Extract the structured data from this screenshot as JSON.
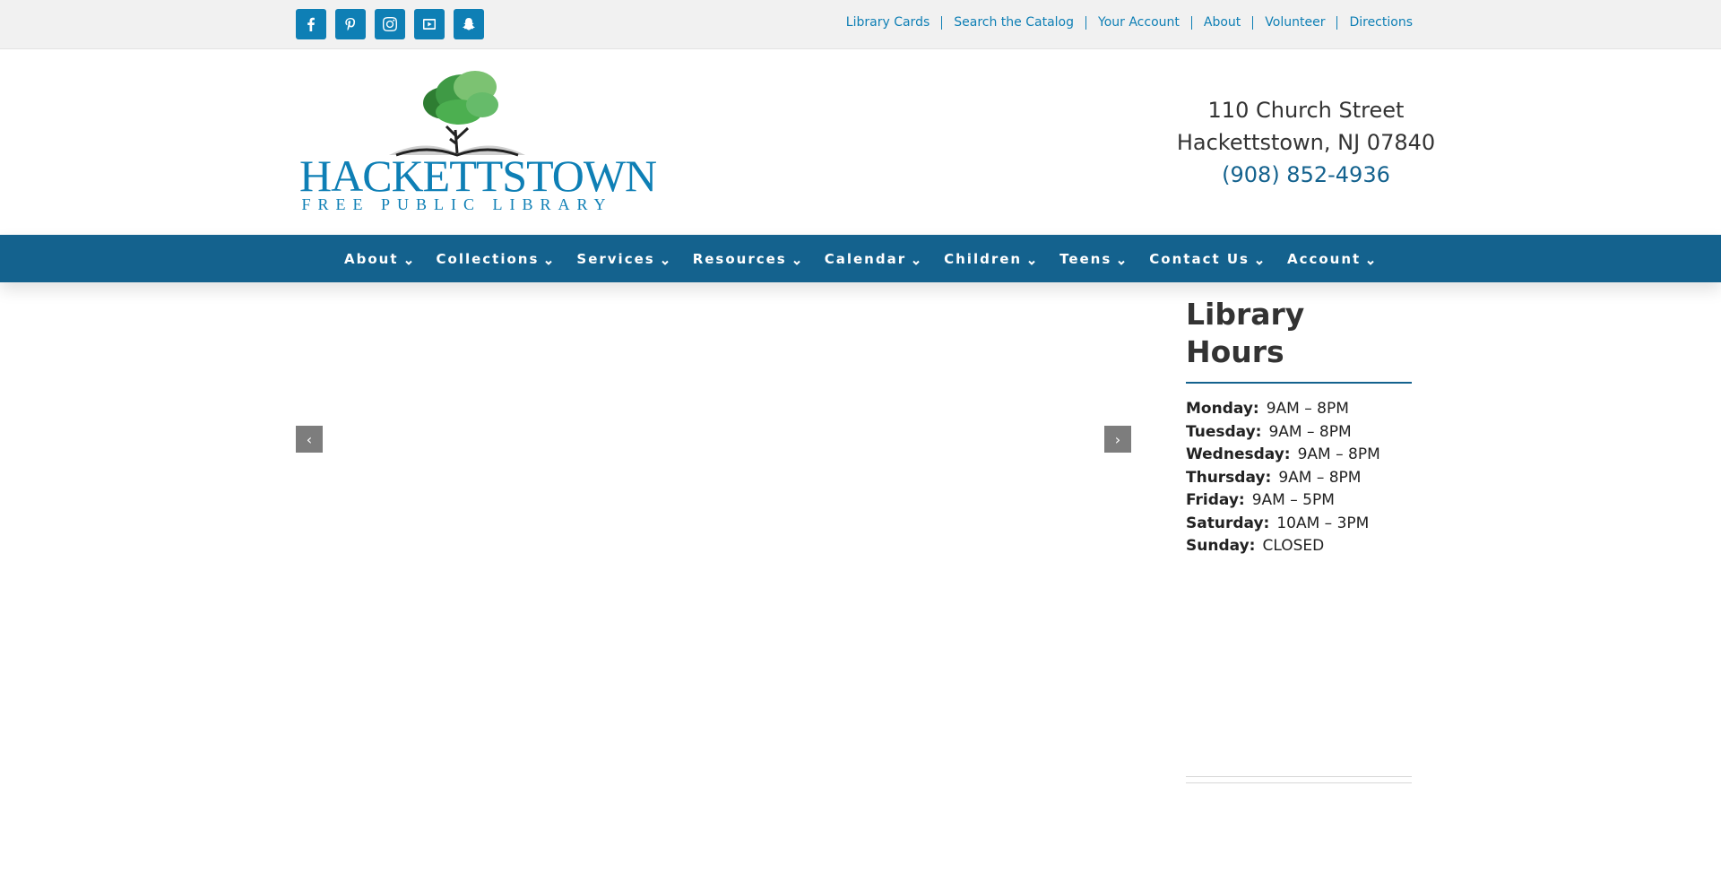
{
  "topbar": {
    "social": [
      {
        "name": "facebook-icon"
      },
      {
        "name": "pinterest-icon"
      },
      {
        "name": "instagram-icon"
      },
      {
        "name": "youtube-icon"
      },
      {
        "name": "snapchat-icon"
      }
    ],
    "links": [
      "Library Cards",
      "Search the Catalog",
      "Your Account",
      "About",
      "Volunteer",
      "Directions"
    ]
  },
  "logo": {
    "title": "HACKETTSTOWN",
    "subtitle": "FREE PUBLIC LIBRARY"
  },
  "address": {
    "street": "110 Church Street",
    "city": "Hackettstown, NJ 07840",
    "phone": "(908) 852-4936"
  },
  "nav": {
    "items": [
      "About",
      "Collections",
      "Services",
      "Resources",
      "Calendar",
      "Children",
      "Teens",
      "Contact Us",
      "Account"
    ]
  },
  "slider": {
    "prev": "‹",
    "next": "›"
  },
  "hours": {
    "title": "Library Hours",
    "rows": [
      {
        "day": "Monday:",
        "time": "9AM – 8PM"
      },
      {
        "day": "Tuesday:",
        "time": "9AM – 8PM"
      },
      {
        "day": "Wednesday:",
        "time": "9AM – 8PM"
      },
      {
        "day": "Thursday:",
        "time": "9AM – 8PM"
      },
      {
        "day": "Friday:",
        "time": "9AM – 5PM"
      },
      {
        "day": "Saturday:",
        "time": "10AM – 3PM"
      },
      {
        "day": "Sunday:",
        "time": "CLOSED"
      }
    ]
  },
  "colors": {
    "brand_blue": "#0e7fb5",
    "nav_blue": "#14628e",
    "topbar_bg": "#f1f1f1"
  }
}
